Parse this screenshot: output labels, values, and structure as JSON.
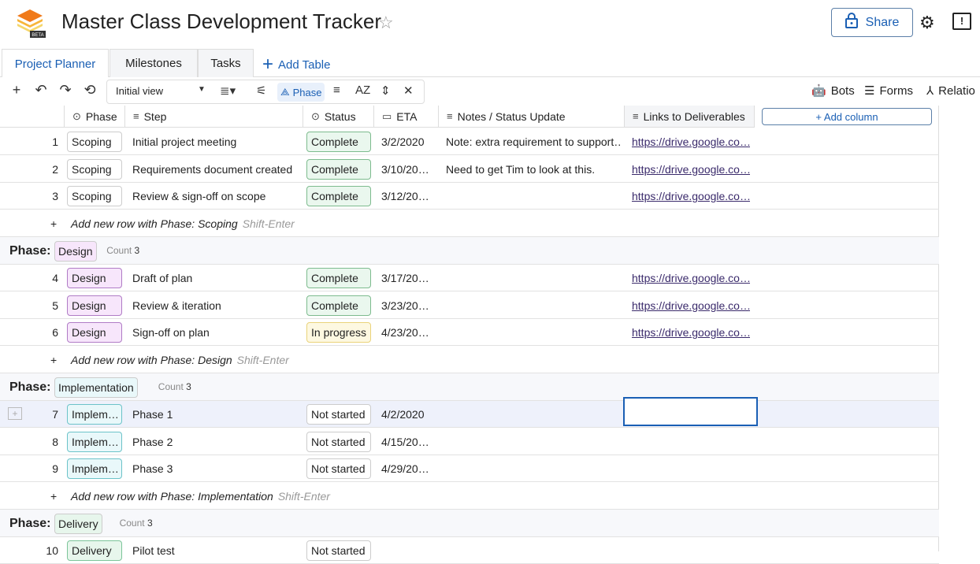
{
  "app": {
    "title": "Master Class Development Tracker",
    "logo_badge": "BETA",
    "share_label": "Share"
  },
  "tabs": [
    {
      "label": "Project Planner",
      "active": true
    },
    {
      "label": "Milestones",
      "active": false
    },
    {
      "label": "Tasks",
      "active": false
    }
  ],
  "add_table_label": "Add Table",
  "toolbar": {
    "view_name": "Initial view",
    "group_chip": "Phase",
    "bots_label": "Bots",
    "forms_label": "Forms",
    "relations_label": "Relatio"
  },
  "columns": [
    {
      "label": "Phase",
      "icon": "dropdown-circle-icon"
    },
    {
      "label": "Step",
      "icon": "text-lines-icon"
    },
    {
      "label": "Status",
      "icon": "dropdown-circle-icon"
    },
    {
      "label": "ETA",
      "icon": "calendar-icon"
    },
    {
      "label": "Notes / Status Update",
      "icon": "text-lines-icon"
    },
    {
      "label": "Links to Deliverables",
      "icon": "text-lines-icon"
    }
  ],
  "add_column_label": "+ Add column",
  "group_prefix": "Phase:",
  "count_label": "Count",
  "groups": [
    {
      "phase": "Scoping",
      "count": "3",
      "add_row": "Add new row with Phase: Scoping",
      "rows": [
        {
          "num": "1",
          "phase": "Scoping",
          "step": "Initial project meeting",
          "status": "Complete",
          "eta": "3/2/2020",
          "notes": "Note: extra requirement to support…",
          "link": "https://drive.google.co…"
        },
        {
          "num": "2",
          "phase": "Scoping",
          "step": "Requirements document created",
          "status": "Complete",
          "eta": "3/10/20…",
          "notes": "Need to get Tim to look at this.",
          "link": "https://drive.google.co…"
        },
        {
          "num": "3",
          "phase": "Scoping",
          "step": "Review & sign-off on scope",
          "status": "Complete",
          "eta": "3/12/20…",
          "notes": "",
          "link": "https://drive.google.co…"
        }
      ]
    },
    {
      "phase": "Design",
      "count": "3",
      "add_row": "Add new row with Phase: Design",
      "rows": [
        {
          "num": "4",
          "phase": "Design",
          "step": "Draft of plan",
          "status": "Complete",
          "eta": "3/17/20…",
          "notes": "",
          "link": "https://drive.google.co…"
        },
        {
          "num": "5",
          "phase": "Design",
          "step": "Review & iteration",
          "status": "Complete",
          "eta": "3/23/20…",
          "notes": "",
          "link": "https://drive.google.co…"
        },
        {
          "num": "6",
          "phase": "Design",
          "step": "Sign-off on plan",
          "status": "In progress",
          "eta": "4/23/20…",
          "notes": "",
          "link": "https://drive.google.co…"
        }
      ]
    },
    {
      "phase": "Implementation",
      "count": "3",
      "add_row": "Add new row with Phase: Implementation",
      "rows": [
        {
          "num": "7",
          "phase": "Implem…",
          "step": "Phase 1",
          "status": "Not started",
          "eta": "4/2/2020",
          "notes": "",
          "link": ""
        },
        {
          "num": "8",
          "phase": "Implem…",
          "step": "Phase 2",
          "status": "Not started",
          "eta": "4/15/20…",
          "notes": "",
          "link": ""
        },
        {
          "num": "9",
          "phase": "Implem…",
          "step": "Phase 3",
          "status": "Not started",
          "eta": "4/29/20…",
          "notes": "",
          "link": ""
        }
      ]
    },
    {
      "phase": "Delivery",
      "count": "3",
      "rows": [
        {
          "num": "10",
          "phase": "Delivery",
          "step": "Pilot test",
          "status": "Not started",
          "eta": "",
          "notes": "",
          "link": ""
        }
      ]
    }
  ],
  "shortcut_hint": "Shift-Enter",
  "colors": {
    "accent": "#1a5fb4",
    "complete": "#eaf7ee",
    "in_progress": "#fdf8e1",
    "design": "#f7e6fb",
    "implementation": "#e9f8fa",
    "delivery": "#e7f6ec"
  }
}
